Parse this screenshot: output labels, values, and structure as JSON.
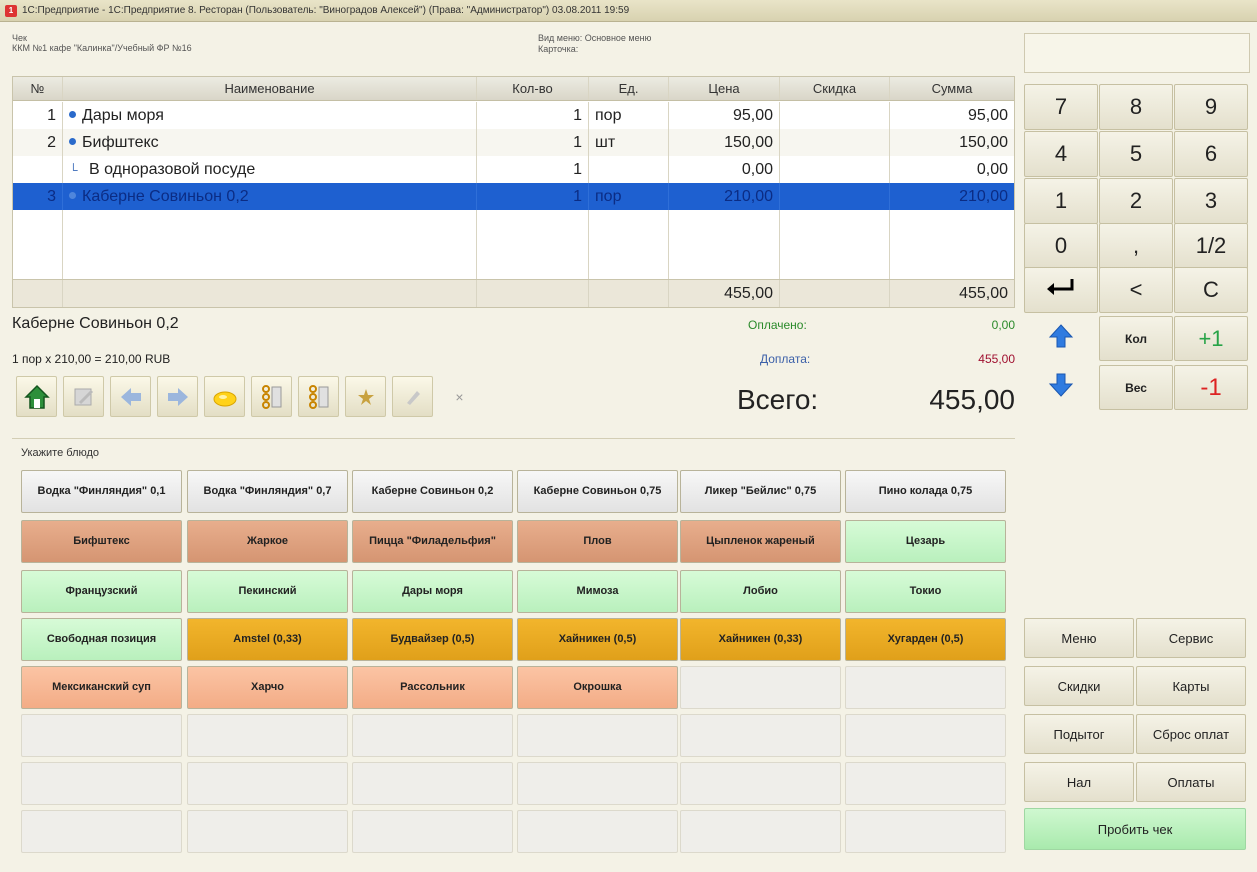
{
  "window": {
    "title": "1С:Предприятие - 1С:Предприятие 8. Ресторан (Пользователь: \"Виноградов Алексей\") (Права: \"Администратор\") 03.08.2011 19:59"
  },
  "header": {
    "check_label": "Чек",
    "kkm": "ККМ №1 кафе \"Калинка\"/Учебный ФР №16",
    "menu_view": "Вид меню: Основное меню",
    "card": "Карточка:"
  },
  "receipt": {
    "columns": [
      "№",
      "Наименование",
      "Кол-во",
      "Ед.",
      "Цена",
      "Скидка",
      "Сумма"
    ],
    "rows": [
      {
        "no": "1",
        "name": "Дары моря",
        "qty": "1",
        "unit": "пор",
        "price": "95,00",
        "discount": "",
        "sum": "95,00"
      },
      {
        "no": "2",
        "name": "Бифштекс",
        "qty": "1",
        "unit": "шт",
        "price": "150,00",
        "discount": "",
        "sum": "150,00"
      },
      {
        "no": "",
        "name": "В одноразовой посуде",
        "qty": "1",
        "unit": "",
        "price": "0,00",
        "discount": "",
        "sum": "0,00"
      },
      {
        "no": "3",
        "name": "Каберне Совиньон 0,2",
        "qty": "1",
        "unit": "пор",
        "price": "210,00",
        "discount": "",
        "sum": "210,00"
      }
    ],
    "totals": {
      "price": "455,00",
      "sum": "455,00"
    }
  },
  "info": {
    "selected_name": "Каберне Совиньон 0,2",
    "selected_detail": "1 пор х 210,00 = 210,00 RUB",
    "paid_label": "Оплачено:",
    "paid_value": "0,00",
    "due_label": "Доплата:",
    "due_value": "455,00",
    "total_label": "Всего:",
    "total_value": "455,00"
  },
  "toolbar": {
    "icons": [
      "home-icon",
      "edit-icon",
      "arrow-left-icon",
      "arrow-right-icon",
      "lemon-icon",
      "sort-up-icon",
      "sort-down-icon",
      "star-icon",
      "pencil-icon"
    ],
    "close_glyph": "×"
  },
  "dishes": {
    "prompt": "Укажите блюдо",
    "items": [
      [
        "Водка \"Финляндия\" 0,1",
        "grey"
      ],
      [
        "Водка \"Финляндия\" 0,7",
        "grey"
      ],
      [
        "Каберне Совиньон 0,2",
        "grey"
      ],
      [
        "Каберне Совиньон 0,75",
        "grey"
      ],
      [
        "Ликер \"Бейлис\" 0,75",
        "grey"
      ],
      [
        "Пино колада 0,75",
        "grey"
      ],
      [
        "Бифштекс",
        "brown"
      ],
      [
        "Жаркое",
        "brown"
      ],
      [
        "Пицца \"Филадельфия\"",
        "brown"
      ],
      [
        "Плов",
        "brown"
      ],
      [
        "Цыпленок жареный",
        "brown"
      ],
      [
        "Цезарь",
        "green"
      ],
      [
        "Французский",
        "green"
      ],
      [
        "Пекинский",
        "green"
      ],
      [
        "Дары моря",
        "green"
      ],
      [
        "Мимоза",
        "green"
      ],
      [
        "Лобио",
        "green"
      ],
      [
        "Токио",
        "green"
      ],
      [
        "Свободная позиция",
        "green"
      ],
      [
        "Amstel (0,33)",
        "orange"
      ],
      [
        "Будвайзер (0,5)",
        "orange"
      ],
      [
        "Хайникен (0,5)",
        "orange"
      ],
      [
        "Хайникен (0,33)",
        "orange"
      ],
      [
        "Хугарден (0,5)",
        "orange"
      ],
      [
        "Мексиканский суп",
        "salmon"
      ],
      [
        "Харчо",
        "salmon"
      ],
      [
        "Рассольник",
        "salmon"
      ],
      [
        "Окрошка",
        "salmon"
      ]
    ]
  },
  "keypad": {
    "keys": [
      "7",
      "8",
      "9",
      "4",
      "5",
      "6",
      "1",
      "2",
      "3",
      "0",
      ",",
      "1/2",
      "enter-icon",
      "<",
      "C",
      "arrow-up-icon",
      "Кол",
      "+1",
      "arrow-down-icon",
      "Вес",
      "-1"
    ]
  },
  "functions": {
    "menu": "Меню",
    "service": "Сервис",
    "discounts": "Скидки",
    "cards": "Карты",
    "subtotal": "Подытог",
    "reset_payments": "Сброс оплат",
    "cash": "Нал",
    "payments": "Оплаты",
    "print_check": "Пробить чек"
  },
  "colors": {
    "selection": "#1e60d0",
    "grey": "#e8e8e8",
    "brown": "#dc9b78",
    "green": "#c4f5c6",
    "orange": "#e9a81f",
    "salmon": "#f6b693",
    "paid": "#2a8a2a",
    "due": "#a01030"
  }
}
